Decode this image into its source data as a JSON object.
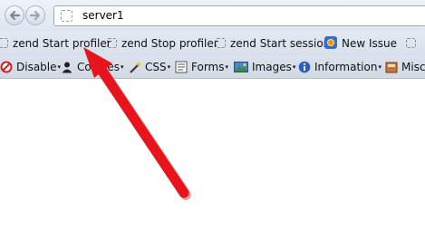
{
  "browser": {
    "url": "server1"
  },
  "bookmarks": [
    {
      "label": "zend Start profiler"
    },
    {
      "label": "zend Stop profiler"
    },
    {
      "label": "zend Start session"
    },
    {
      "label": "New Issue"
    }
  ],
  "dev_toolbar": [
    {
      "label": "Disable",
      "icon": "disable-icon"
    },
    {
      "label": "Cookies",
      "icon": "cookie-user-icon"
    },
    {
      "label": "CSS",
      "icon": "css-wand-icon"
    },
    {
      "label": "Forms",
      "icon": "forms-icon"
    },
    {
      "label": "Images",
      "icon": "images-icon"
    },
    {
      "label": "Information",
      "icon": "info-icon"
    },
    {
      "label": "Misc",
      "icon": "misc-icon"
    }
  ],
  "colors": {
    "annotation_arrow": "#e8141c",
    "toolbar_bg": "#dfe6f0"
  }
}
